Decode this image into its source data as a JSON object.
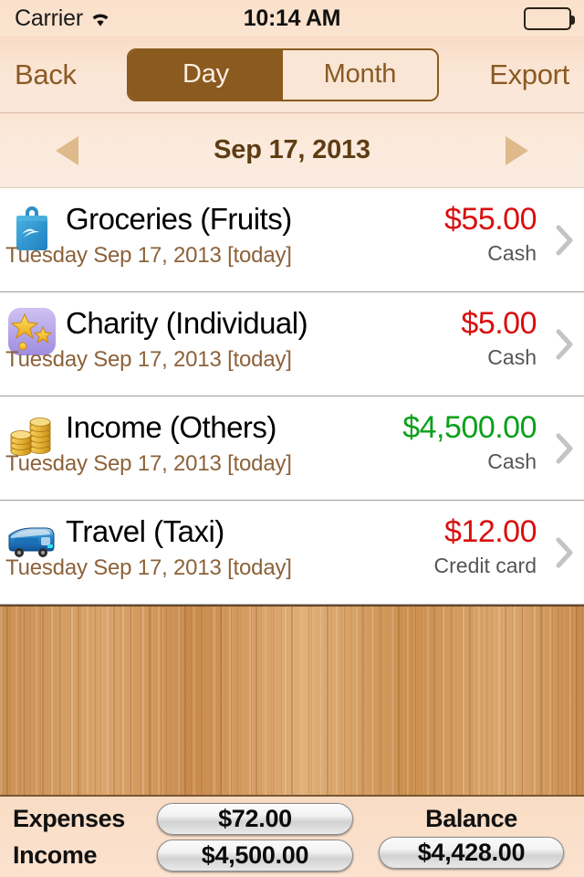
{
  "status_bar": {
    "carrier": "Carrier",
    "wifi_icon": "wifi-icon",
    "time": "10:14 AM",
    "battery_icon": "battery-full-icon"
  },
  "nav_bar": {
    "back_label": "Back",
    "export_label": "Export",
    "segments": [
      {
        "label": "Day",
        "active": true
      },
      {
        "label": "Month",
        "active": false
      }
    ]
  },
  "date_bar": {
    "prev_icon": "triangle-left-icon",
    "next_icon": "triangle-right-icon",
    "date": "Sep 17, 2013"
  },
  "colors": {
    "brand_brown": "#8b5a1f",
    "expense_red": "#d81010",
    "income_green": "#0aa01a",
    "subtitle_brown": "#8c6239",
    "wood": "#d09a5e"
  },
  "transactions": [
    {
      "icon": "shopping-bag-icon",
      "title": "Groceries (Fruits)",
      "subtitle": "Tuesday Sep 17, 2013 [today]",
      "amount": "$55.00",
      "kind": "expense",
      "method": "Cash",
      "chevron_icon": "chevron-right-icon"
    },
    {
      "icon": "stars-icon",
      "title": "Charity (Individual)",
      "subtitle": "Tuesday Sep 17, 2013 [today]",
      "amount": "$5.00",
      "kind": "expense",
      "method": "Cash",
      "chevron_icon": "chevron-right-icon"
    },
    {
      "icon": "coins-icon",
      "title": "Income (Others)",
      "subtitle": "Tuesday Sep 17, 2013 [today]",
      "amount": "$4,500.00",
      "kind": "income",
      "method": "Cash",
      "chevron_icon": "chevron-right-icon"
    },
    {
      "icon": "bus-icon",
      "title": "Travel (Taxi)",
      "subtitle": "Tuesday Sep 17, 2013 [today]",
      "amount": "$12.00",
      "kind": "expense",
      "method": "Credit card",
      "chevron_icon": "chevron-right-icon"
    }
  ],
  "summary": {
    "expenses_label": "Expenses",
    "expenses_value": "$72.00",
    "income_label": "Income",
    "income_value": "$4,500.00",
    "balance_label": "Balance",
    "balance_value": "$4,428.00"
  }
}
